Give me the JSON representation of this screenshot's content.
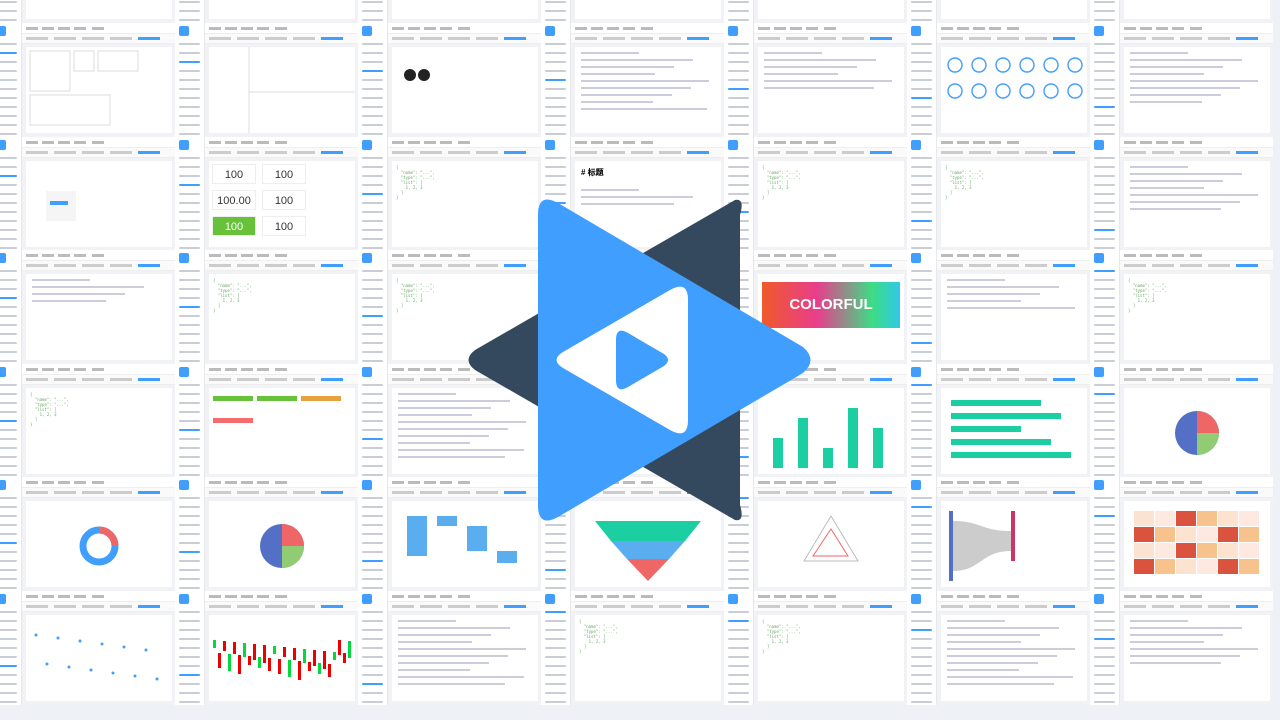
{
  "collage": {
    "rows": [
      [
        "form",
        "text",
        "blank",
        "form",
        "calendar",
        "icons",
        "list"
      ],
      [
        "cards",
        "split",
        "github",
        "checkbox",
        "calendar",
        "icons",
        "list"
      ],
      [
        "cascader",
        "numbers",
        "code",
        "markdown",
        "code",
        "code",
        "text"
      ],
      [
        "form",
        "code",
        "code",
        "code",
        "colorful",
        "buttons",
        "code"
      ],
      [
        "code",
        "tags",
        "table",
        "table",
        "barline",
        "hbar",
        "pie"
      ],
      [
        "donut",
        "pie",
        "waterfall",
        "funnel",
        "radar",
        "sankey",
        "heatmap"
      ],
      [
        "scatter",
        "candles",
        "table",
        "code",
        "code",
        "table",
        "text"
      ]
    ],
    "texts": {
      "numbers": [
        "100",
        "100",
        "100.00",
        "100",
        "100",
        "100"
      ],
      "colorful": "COLORFUL",
      "markdown": "# 标题"
    },
    "colors": {
      "accent": "#409eff",
      "logo_dark": "#35495e",
      "logo_blue": "#409eff",
      "green": "#1ccfa3"
    }
  },
  "logo": {
    "name": "play-triangle-logo"
  }
}
